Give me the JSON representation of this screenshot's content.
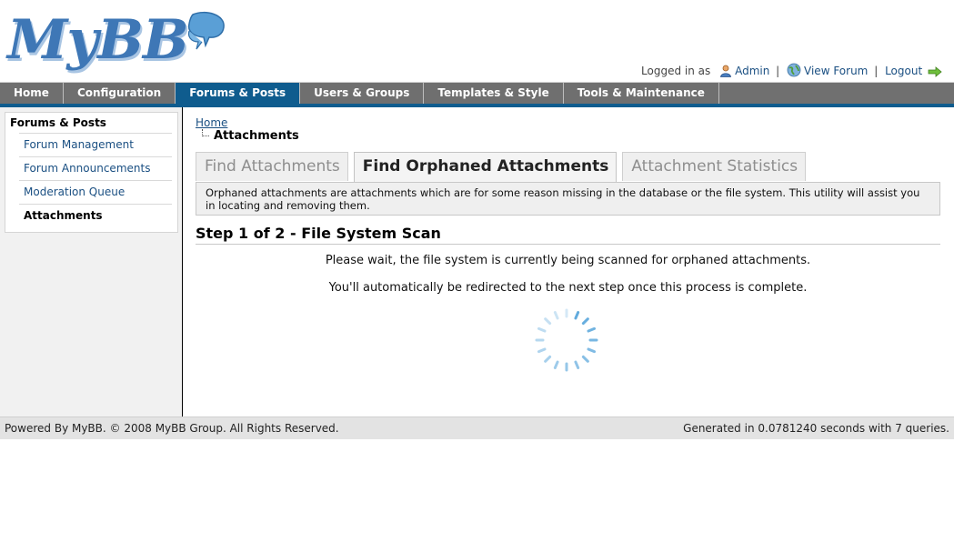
{
  "logo": {
    "text": "MyBB"
  },
  "user_bar": {
    "logged_in_label": "Logged in as",
    "username": "Admin",
    "view_forum": "View Forum",
    "logout": "Logout",
    "separator": "|"
  },
  "menu": {
    "items": [
      {
        "label": "Home"
      },
      {
        "label": "Configuration"
      },
      {
        "label": "Forums & Posts"
      },
      {
        "label": "Users & Groups"
      },
      {
        "label": "Templates & Style"
      },
      {
        "label": "Tools & Maintenance"
      }
    ],
    "active": "Forums & Posts"
  },
  "sidebar": {
    "title": "Forums & Posts",
    "items": [
      {
        "label": "Forum Management"
      },
      {
        "label": "Forum Announcements"
      },
      {
        "label": "Moderation Queue"
      },
      {
        "label": "Attachments"
      }
    ],
    "active": "Attachments"
  },
  "breadcrumb": {
    "home": "Home",
    "current": "Attachments"
  },
  "tabs": {
    "items": [
      {
        "label": "Find Attachments"
      },
      {
        "label": "Find Orphaned Attachments"
      },
      {
        "label": "Attachment Statistics"
      }
    ],
    "active": "Find Orphaned Attachments",
    "description": "Orphaned attachments are attachments which are for some reason missing in the database or the file system. This utility will assist you in locating and removing them."
  },
  "main": {
    "step_title": "Step 1 of 2 - File System Scan",
    "message_wait": "Please wait, the file system is currently being scanned for orphaned attachments.",
    "message_redirect": "You'll automatically be redirected to the next step once this process is complete."
  },
  "footer": {
    "left": "Powered By MyBB. © 2008 MyBB Group. All Rights Reserved.",
    "right": "Generated in 0.0781240 seconds with 7 queries."
  },
  "colors": {
    "menu_bg": "#707070",
    "menu_active": "#0f5c8e",
    "link": "#1a4f82",
    "spinner": "#5aa7dc"
  },
  "icons": {
    "user": "user-icon",
    "globe": "globe-icon",
    "logout": "arrow-right-icon",
    "loading": "spinner-icon"
  }
}
